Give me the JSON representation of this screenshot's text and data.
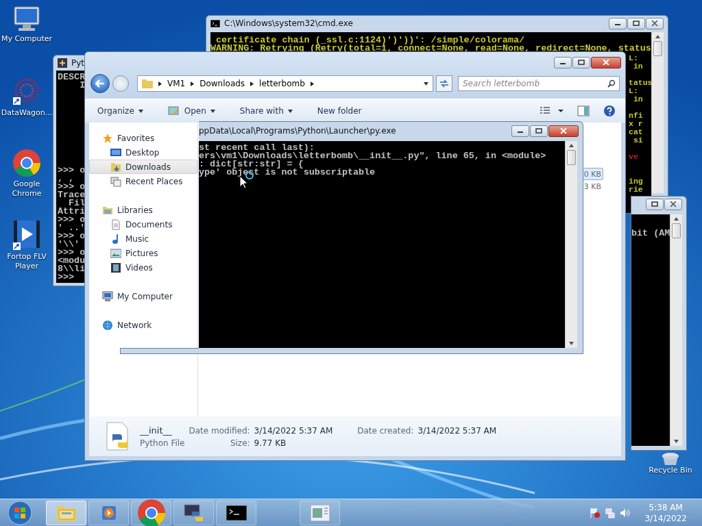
{
  "desktop_icons": [
    {
      "label": "My Computer",
      "kind": "computer"
    },
    {
      "label": "DataWagon...",
      "kind": "burst"
    },
    {
      "label": "Google Chrome",
      "kind": "chrome"
    },
    {
      "label": "Fortop FLV Player",
      "kind": "player"
    }
  ],
  "recycle_bin": {
    "label": "Recycle Bin"
  },
  "cmd_window": {
    "title": "C:\\Windows\\system32\\cmd.exe",
    "lines": [
      {
        "text": "certificate chain (_ssl.c:1124)')'))': /simple/colorama/",
        "color": "#c8c832"
      },
      {
        "text": "WARNING: Retrying (Retry(total=1, connect=None, read=None, redirect=None, status",
        "color": "#c8c832"
      }
    ],
    "fragment_blocks": [
      [
        {
          "text": "L:",
          "color": "#c8c832"
        },
        {
          "text": " in",
          "color": "#c8c832"
        }
      ],
      [
        {
          "text": "tatus",
          "color": "#c8c832"
        },
        {
          "text": "L:",
          "color": "#c8c832"
        },
        {
          "text": " in",
          "color": "#c8c832"
        }
      ],
      [
        {
          "text": "nfi",
          "color": "#c8c832"
        },
        {
          "text": "x r",
          "color": "#c8c832"
        },
        {
          "text": "cat",
          "color": "#c8c832"
        },
        {
          "text": " si",
          "color": "#c8c832"
        }
      ],
      [
        {
          "text": "ve",
          "color": "#c02020"
        }
      ],
      [
        {
          "text": "ing",
          "color": "#c8c832"
        },
        {
          "text": "rie",
          "color": "#c8c832"
        }
      ]
    ]
  },
  "python_window": {
    "title": "Pyt",
    "top_lines": [
      "DESCR",
      "    I"
    ],
    "lines": [
      ">>> o",
      ", ,",
      ">>> o",
      "Trace",
      "  Fil",
      "Attri",
      ">>> o",
      "' ..'",
      ">>> o",
      "'\\\\'",
      ">>> o",
      "<modu",
      "8\\\\li",
      ">>>"
    ]
  },
  "console_window": {
    "lines": [
      "bit (AM"
    ]
  },
  "explorer": {
    "breadcrumb": [
      "VM1",
      "Downloads",
      "letterbomb"
    ],
    "search": {
      "placeholder": "Search letterbomb"
    },
    "toolbar": [
      {
        "label": "Open",
        "kind": "open"
      }
    ],
    "toolbar_menus": [
      "Organize",
      "Share with"
    ],
    "new_folder": "New folder",
    "nav": [
      {
        "label": "Favorites",
        "kind": "star",
        "children": [
          {
            "label": "Desktop",
            "kind": "desktop",
            "selected": false
          },
          {
            "label": "Downloads",
            "kind": "downloads",
            "selected": true
          },
          {
            "label": "Recent Places",
            "kind": "recent",
            "selected": false
          }
        ]
      },
      {
        "label": "Libraries",
        "kind": "libraries",
        "children": [
          {
            "label": "Documents",
            "kind": "document",
            "selected": false
          },
          {
            "label": "Music",
            "kind": "music",
            "selected": false
          },
          {
            "label": "Pictures",
            "kind": "pictures",
            "selected": false
          },
          {
            "label": "Videos",
            "kind": "videos",
            "selected": false
          }
        ]
      },
      {
        "label": "My Computer",
        "kind": "computer"
      },
      {
        "label": "Network",
        "kind": "network"
      }
    ],
    "files": [
      {
        "size": "0 KB",
        "selected": true
      },
      {
        "size": "3 KB",
        "selected": false
      }
    ],
    "details": {
      "name": "__init__",
      "type": "Python File",
      "modified_label": "Date modified:",
      "modified": "3/14/2022 5:37 AM",
      "size_label": "Size:",
      "size": "9.77 KB",
      "created_label": "Date created:",
      "created": "3/14/2022 5:37 AM"
    }
  },
  "py_exe_window": {
    "title": "ppData\\Local\\Programs\\Python\\Launcher\\py.exe",
    "lines": [
      "st recent call last):",
      "ers\\vm1\\Downloads\\letterbomb\\__init__.py\", line 65, in <module>",
      ": dict[str:str] = {",
      "ype' object is not subscriptable"
    ]
  },
  "taskbar": {
    "items": [
      {
        "kind": "explorer",
        "selected": true
      },
      {
        "kind": "media",
        "selected": false
      },
      {
        "kind": "chrome",
        "selected": false
      },
      {
        "kind": "python",
        "selected": false
      },
      {
        "kind": "cmd",
        "selected": false
      },
      {
        "kind": "window",
        "selected": false
      }
    ],
    "time": "5:38 AM",
    "date": "3/14/2022"
  }
}
